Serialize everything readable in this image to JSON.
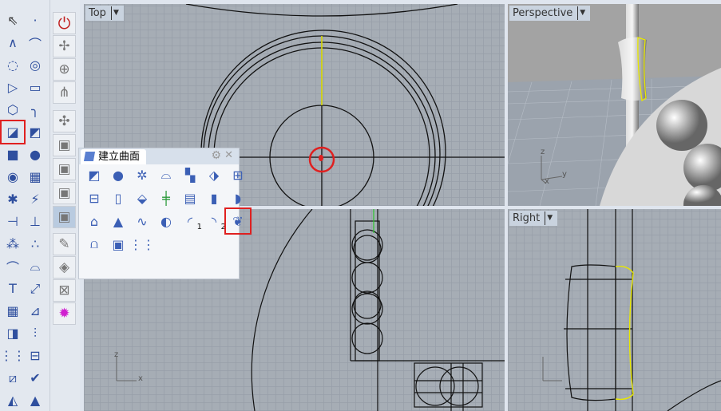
{
  "left_toolbar": {
    "icons": [
      "select-arrow-icon",
      "point-icon",
      "polyline-icon",
      "curve-icon",
      "circle-icon",
      "ellipse-icon",
      "arc-icon",
      "rectangle-icon",
      "polygon-icon",
      "fillet-curve-icon",
      "surface-from-points-icon",
      "extrude-surface-icon",
      "box-icon",
      "sphere-union-icon",
      "cylinder-cut-icon",
      "mesh-surface-icon",
      "explode-icon",
      "boolean-split-icon",
      "trim-icon",
      "split-icon",
      "circles-group-icon",
      "points-group-icon",
      "offset-curve-icon",
      "blend-curve-icon",
      "text-icon",
      "scale-icon",
      "array-icon",
      "align-icon",
      "solid-edit-icon",
      "project-icon",
      "grid-array-icon",
      "dimension-icon",
      "transform-icon",
      "check-icon",
      "shapes-icon",
      "pyramid-light-icon"
    ],
    "selected_index": 10
  },
  "side_toolbar": {
    "icons": [
      "stop-icon",
      "mesh-tool-icon",
      "sphere-grid-icon",
      "network-icon",
      "gumball-icon",
      "view-cube-top-icon",
      "view-cube-front-icon",
      "view-cube-right-icon",
      "view-cube-perspective-icon",
      "render-icon",
      "material-icon",
      "zoom-extents-icon",
      "plugin-gear-icon"
    ]
  },
  "panel": {
    "title": "建立曲面",
    "icons": [
      "surface-from-corners-icon",
      "sphere-surface-icon",
      "loft-spray-icon",
      "sweep1-icon",
      "patch-icon",
      "rail-revolve-icon",
      "planar-surface-icon",
      "edge-surface-icon",
      "vertical-plane-icon",
      "srf-from-network-icon",
      "cutting-plane-icon",
      "heightfield-icon",
      "extrude-cylinder-icon",
      "blend-surface-icon",
      "extrude-dome-icon",
      "cone-icon",
      "sweep-rail-icon",
      "revolve-icon",
      "sweep-1-rail-icon",
      "sweep-2-rail-icon",
      "rail-revolve-selected-icon",
      "drape-icon",
      "image-surface-icon",
      "point-grid-icon"
    ],
    "selected_index": 20,
    "sweep1_label": "1",
    "sweep2_label": "2"
  },
  "viewports": {
    "top": "Top",
    "perspective": "Perspective",
    "right": "Right"
  },
  "axes": {
    "z": "z",
    "x": "x",
    "y": "y"
  },
  "colors": {
    "selection": "#e02020",
    "highlight_curve": "#f0f000",
    "accent": "#3b5fb5"
  }
}
